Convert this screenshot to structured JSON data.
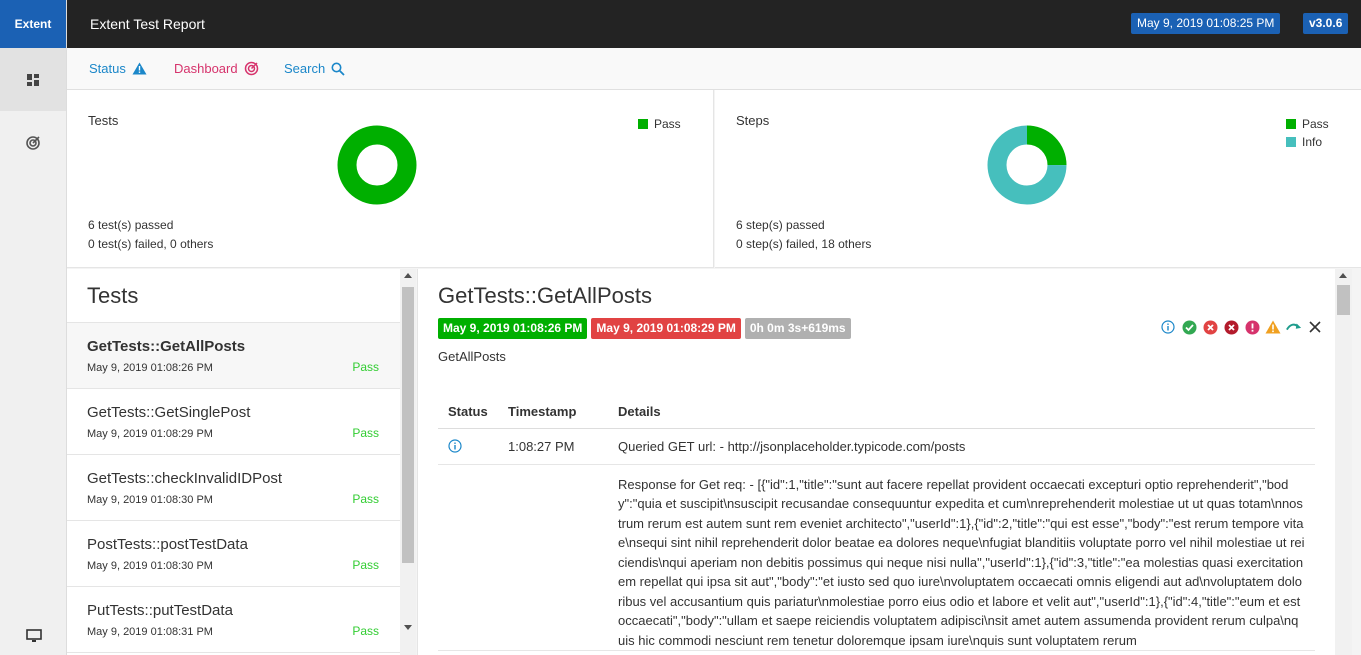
{
  "brand": "Extent",
  "topbar": {
    "report_name": "Extent Test Report",
    "date": "May 9, 2019 01:08:25 PM",
    "version": "v3.0.6"
  },
  "nav": {
    "status": "Status",
    "dashboard": "Dashboard",
    "search": "Search"
  },
  "dashboard": {
    "tests": {
      "title": "Tests",
      "legend": [
        {
          "label": "Pass",
          "color": "#00af00"
        }
      ],
      "passed_count": "6",
      "passed_text": " test(s) passed",
      "failed_count": "0",
      "failed_text": " test(s) failed, ",
      "others_count": "0",
      "others_text": " others",
      "chart_data": {
        "type": "pie",
        "categories": [
          "Pass"
        ],
        "values": [
          6
        ]
      }
    },
    "steps": {
      "title": "Steps",
      "legend": [
        {
          "label": "Pass",
          "color": "#00af00"
        },
        {
          "label": "Info",
          "color": "#46bfbd"
        }
      ],
      "passed_count": "6",
      "passed_text": " step(s) passed",
      "failed_count": "0",
      "failed_text": " step(s) failed, ",
      "others_count": "18",
      "others_text": " others",
      "chart_data": {
        "type": "pie",
        "categories": [
          "Pass",
          "Info"
        ],
        "values": [
          6,
          18
        ]
      }
    }
  },
  "test_list": {
    "heading": "Tests",
    "items": [
      {
        "name": "GetTests::GetAllPosts",
        "time": "May 9, 2019 01:08:26 PM",
        "status": "Pass"
      },
      {
        "name": "GetTests::GetSinglePost",
        "time": "May 9, 2019 01:08:29 PM",
        "status": "Pass"
      },
      {
        "name": "GetTests::checkInvalidIDPost",
        "time": "May 9, 2019 01:08:30 PM",
        "status": "Pass"
      },
      {
        "name": "PostTests::postTestData",
        "time": "May 9, 2019 01:08:30 PM",
        "status": "Pass"
      },
      {
        "name": "PutTests::putTestData",
        "time": "May 9, 2019 01:08:31 PM",
        "status": "Pass"
      }
    ]
  },
  "detail": {
    "title": "GetTests::GetAllPosts",
    "start": "May 9, 2019 01:08:26 PM",
    "end": "May 9, 2019 01:08:29 PM",
    "duration": "0h 0m 3s+619ms",
    "description": "GetAllPosts",
    "columns": [
      "Status",
      "Timestamp",
      "Details"
    ],
    "logs": [
      {
        "status_icon": "info-icon",
        "timestamp": "1:08:27 PM",
        "details": "Queried GET url: - http://jsonplaceholder.typicode.com/posts"
      },
      {
        "status_icon": "",
        "timestamp": "",
        "details": "Response for Get req: - [{\"id\":1,\"title\":\"sunt aut facere repellat provident occaecati excepturi optio reprehenderit\",\"body\":\"quia et suscipit\\nsuscipit recusandae consequuntur expedita et cum\\nreprehenderit molestiae ut ut quas totam\\nnostrum rerum est autem sunt rem eveniet architecto\",\"userId\":1},{\"id\":2,\"title\":\"qui est esse\",\"body\":\"est rerum tempore vitae\\nsequi sint nihil reprehenderit dolor beatae ea dolores neque\\nfugiat blanditiis voluptate porro vel nihil molestiae ut reiciendis\\nqui aperiam non debitis possimus qui neque nisi nulla\",\"userId\":1},{\"id\":3,\"title\":\"ea molestias quasi exercitationem repellat qui ipsa sit aut\",\"body\":\"et iusto sed quo iure\\nvoluptatem occaecati omnis eligendi aut ad\\nvoluptatem doloribus vel accusantium quis pariatur\\nmolestiae porro eius odio et labore et velit aut\",\"userId\":1},{\"id\":4,\"title\":\"eum et est occaecati\",\"body\":\"ullam et saepe reiciendis voluptatem adipisci\\nsit amet autem assumenda provident rerum culpa\\nquis hic commodi nesciunt rem tenetur doloremque ipsam iure\\nquis sunt voluptatem rerum"
      }
    ]
  },
  "colors": {
    "brand": "#1b61b4",
    "pass": "#00af00",
    "info": "#46bfbd",
    "fail": "#e14343",
    "nav_status": "#1b87c9",
    "nav_dashboard": "#d6336c"
  }
}
